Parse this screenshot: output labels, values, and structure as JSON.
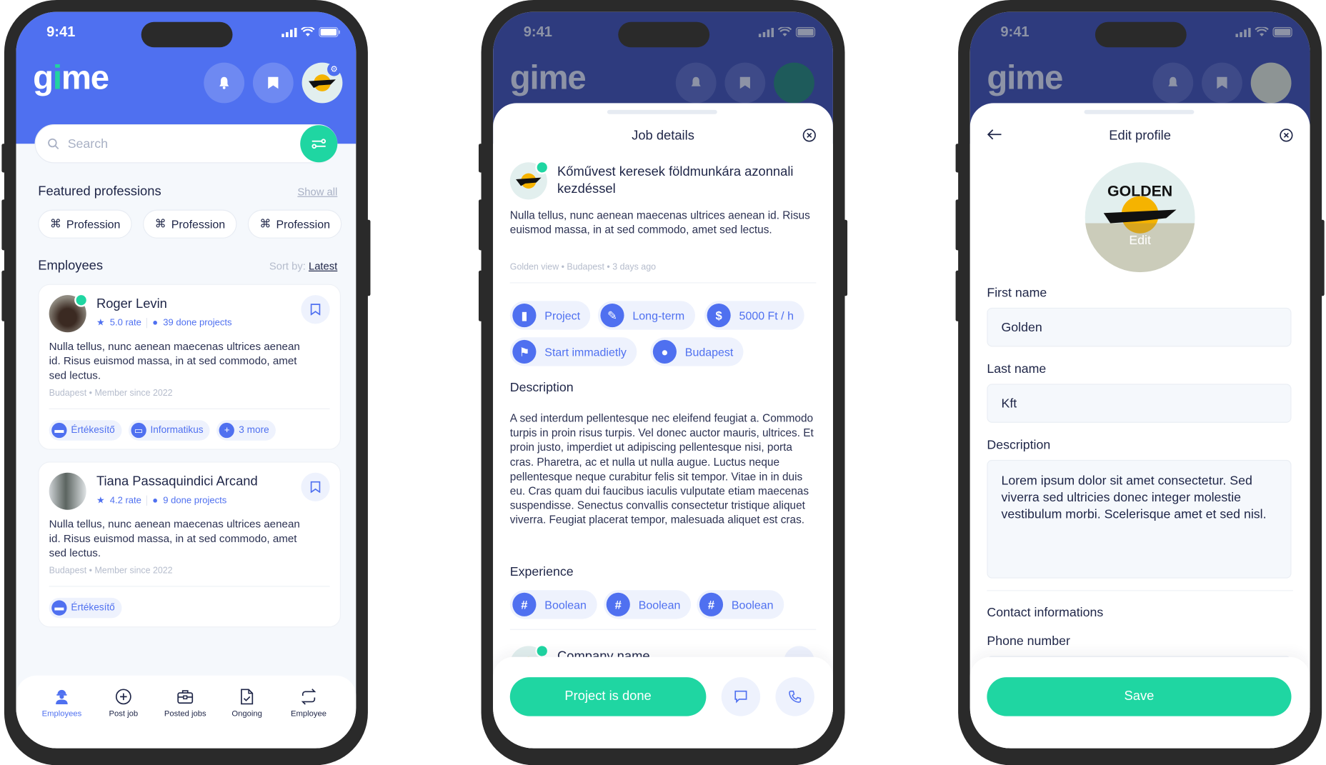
{
  "status_bar": {
    "time": "9:41"
  },
  "app": {
    "logo_g": "g",
    "logo_i": "i",
    "logo_me": "me"
  },
  "home": {
    "search": {
      "placeholder": "Search"
    },
    "featured": {
      "title": "Featured professions",
      "show_all": "Show all",
      "chips": [
        "Profession",
        "Profession",
        "Profession"
      ]
    },
    "employees": {
      "title": "Employees",
      "sort_label": "Sort by:",
      "sort_value": "Latest",
      "cards": [
        {
          "name": "Roger Levin",
          "rate": "5.0 rate",
          "projects": "39 done projects",
          "description": "Nulla tellus, nunc aenean maecenas ultrices aenean id. Risus euismod massa, in at sed commodo, amet sed lectus.",
          "location": "Budapest",
          "member": "Member since 2022",
          "tags": [
            "Értékesítő",
            "Informatikus",
            "3 more"
          ]
        },
        {
          "name": "Tiana Passaquindici Arcand",
          "rate": "4.2 rate",
          "projects": "9 done projects",
          "description": "Nulla tellus, nunc aenean maecenas ultrices aenean id. Risus euismod massa, in at sed commodo, amet sed lectus.",
          "location": "Budapest",
          "member": "Member since 2022",
          "tags": [
            "Értékesítő"
          ]
        }
      ]
    },
    "nav": [
      {
        "label": "Employees",
        "icon": "worker-icon",
        "active": true
      },
      {
        "label": "Post job",
        "icon": "plus-circle-icon"
      },
      {
        "label": "Posted jobs",
        "icon": "briefcase-icon"
      },
      {
        "label": "Ongoing",
        "icon": "document-check-icon"
      },
      {
        "label": "Employee",
        "icon": "swap-icon"
      }
    ]
  },
  "job_details": {
    "title": "Job details",
    "job_title": "Kőművest keresek földmunkára azonnali kezdéssel",
    "summary": "Nulla tellus, nunc aenean maecenas ultrices aenean id. Risus euismod massa, in at sed commodo, amet sed lectus.",
    "company": "Golden view",
    "location": "Budapest",
    "posted": "3 days ago",
    "tags": [
      {
        "label": "Project",
        "icon": "document-icon"
      },
      {
        "label": "Long-term",
        "icon": "contract-icon"
      },
      {
        "label": "5000 Ft / h",
        "icon": "dollar-icon"
      },
      {
        "label": "Start immadietly",
        "icon": "flag-icon"
      },
      {
        "label": "Budapest",
        "icon": "location-pin-icon"
      }
    ],
    "description_title": "Description",
    "description": "A sed interdum pellentesque nec eleifend feugiat a. Commodo turpis in proin risus turpis. Vel donec auctor mauris, ultrices. Et proin justo, imperdiet ut adipiscing pellentesque nisi, porta cras. Pharetra, ac et nulla ut nulla augue. Luctus neque pellentesque neque curabitur felis sit tempor. Vitae in in duis eu. Cras quam dui faucibus iaculis vulputate etiam maecenas suspendisse. Senectus convallis consectetur tristique aliquet viverra. Feugiat placerat tempor, malesuada aliquet est cras.",
    "experience_title": "Experience",
    "experience": [
      "Boolean",
      "Boolean",
      "Boolean"
    ],
    "company_name": "Company name",
    "primary_action": "Project is done"
  },
  "edit_profile": {
    "title": "Edit profile",
    "avatar_text": "GOLDEN",
    "avatar_edit": "Edit",
    "first_name_label": "First name",
    "first_name": "Golden",
    "last_name_label": "Last name",
    "last_name": "Kft",
    "description_label": "Description",
    "description": "Lorem ipsum dolor sit amet consectetur. Sed viverra sed ultricies donec integer molestie vestibulum morbi. Scelerisque amet et sed nisl.",
    "contact_title": "Contact informations",
    "phone_label": "Phone number",
    "save": "Save"
  },
  "colors": {
    "primary": "#4f70f0",
    "accent": "#1fd6a2",
    "text": "#1e2547",
    "muted": "#b5bccc"
  }
}
